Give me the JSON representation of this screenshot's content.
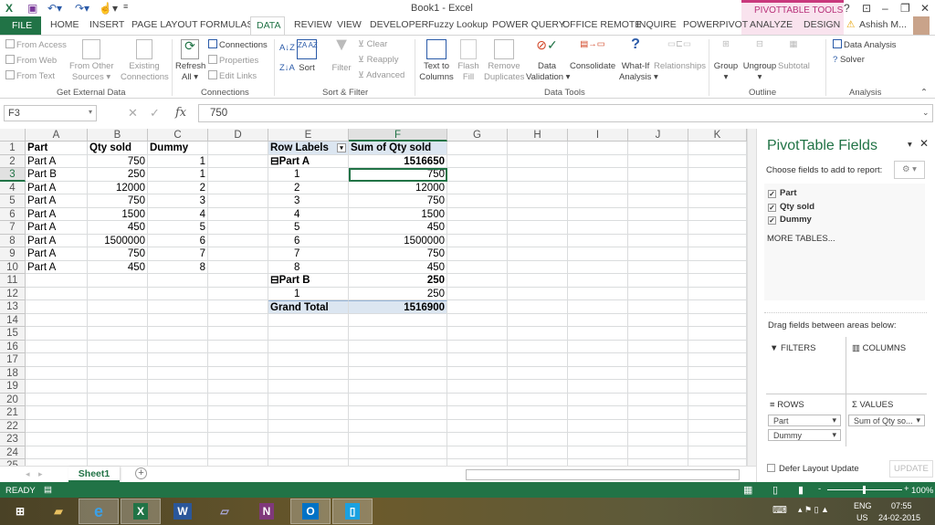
{
  "window": {
    "title": "Book1 - Excel",
    "context_tab": "PIVOTTABLE TOOLS",
    "user": "Ashish M...",
    "help": "?",
    "minimize": "–",
    "restore": "❐",
    "close": "✕"
  },
  "tabs": [
    "FILE",
    "HOME",
    "INSERT",
    "PAGE LAYOUT",
    "FORMULAS",
    "DATA",
    "REVIEW",
    "VIEW",
    "DEVELOPER",
    "Fuzzy Lookup",
    "POWER QUERY",
    "OFFICE REMOTE",
    "INQUIRE",
    "POWERPIVOT",
    "ANALYZE",
    "DESIGN"
  ],
  "active_tab": "DATA",
  "ribbon": {
    "get_external": {
      "from_access": "From Access",
      "from_web": "From Web",
      "from_text": "From Text",
      "from_other": "From Other",
      "from_other2": "Sources ▾",
      "existing": "Existing",
      "existing2": "Connections",
      "label": "Get External Data"
    },
    "connections": {
      "refresh": "Refresh",
      "refresh2": "All ▾",
      "connections": "Connections",
      "properties": "Properties",
      "edit_links": "Edit Links",
      "label": "Connections"
    },
    "sort_filter": {
      "sort": "Sort",
      "filter": "Filter",
      "clear": "Clear",
      "reapply": "Reapply",
      "advanced": "Advanced",
      "label": "Sort & Filter"
    },
    "data_tools": {
      "text_to": "Text to",
      "columns": "Columns",
      "flash": "Flash",
      "fill": "Fill",
      "remove": "Remove",
      "duplicates": "Duplicates",
      "data": "Data",
      "validation": "Validation ▾",
      "consolidate": "Consolidate",
      "whatif": "What-If",
      "analysis": "Analysis ▾",
      "relationships": "Relationships",
      "label": "Data Tools"
    },
    "outline": {
      "group": "Group",
      "ungroup": "Ungroup",
      "subtotal": "Subtotal",
      "label": "Outline"
    },
    "analysis": {
      "data_analysis": "Data Analysis",
      "solver": "Solver",
      "label": "Analysis"
    }
  },
  "formula_bar": {
    "name_box": "F3",
    "formula": "750",
    "fx": "fx"
  },
  "columns": [
    "A",
    "B",
    "C",
    "D",
    "E",
    "F",
    "G",
    "H",
    "I",
    "J",
    "K"
  ],
  "cells": [
    [
      "Part",
      "Qty sold",
      "Dummy",
      "",
      "Row Labels",
      "Sum of Qty sold"
    ],
    [
      "Part A",
      "750",
      "1",
      "",
      "⊟Part A",
      "1516650"
    ],
    [
      "Part B",
      "250",
      "1",
      "",
      "1",
      "750"
    ],
    [
      "Part A",
      "12000",
      "2",
      "",
      "2",
      "12000"
    ],
    [
      "Part A",
      "750",
      "3",
      "",
      "3",
      "750"
    ],
    [
      "Part A",
      "1500",
      "4",
      "",
      "4",
      "1500"
    ],
    [
      "Part A",
      "450",
      "5",
      "",
      "5",
      "450"
    ],
    [
      "Part A",
      "1500000",
      "6",
      "",
      "6",
      "1500000"
    ],
    [
      "Part A",
      "750",
      "7",
      "",
      "7",
      "750"
    ],
    [
      "Part A",
      "450",
      "8",
      "",
      "8",
      "450"
    ],
    [
      "",
      "",
      "",
      "",
      "⊟Part B",
      "250"
    ],
    [
      "",
      "",
      "",
      "",
      "1",
      "250"
    ],
    [
      "",
      "",
      "",
      "",
      "Grand Total",
      "1516900"
    ]
  ],
  "row_count": 25,
  "selected_cell": "F3",
  "sheet": {
    "tab": "Sheet1",
    "add": "+"
  },
  "pivot_panel": {
    "title": "PivotTable Fields",
    "choose": "Choose fields to add to report:",
    "fields": [
      {
        "name": "Part",
        "checked": true
      },
      {
        "name": "Qty sold",
        "checked": true
      },
      {
        "name": "Dummy",
        "checked": true
      }
    ],
    "more_tables": "MORE TABLES...",
    "drag": "Drag fields between areas below:",
    "filters": "FILTERS",
    "columns": "COLUMNS",
    "rows": "ROWS",
    "values": "VALUES",
    "row_items": [
      "Part",
      "Dummy"
    ],
    "value_items": [
      "Sum of Qty so..."
    ],
    "defer": "Defer Layout Update",
    "update": "UPDATE"
  },
  "status": {
    "ready": "READY",
    "zoom": "100%"
  },
  "taskbar": {
    "lang1": "ENG",
    "lang2": "US",
    "time": "07:55",
    "date": "24-02-2015"
  },
  "colors": {
    "excel_green": "#217346",
    "pivot_header": "#dce6f1",
    "context_pink": "#c9397d"
  }
}
